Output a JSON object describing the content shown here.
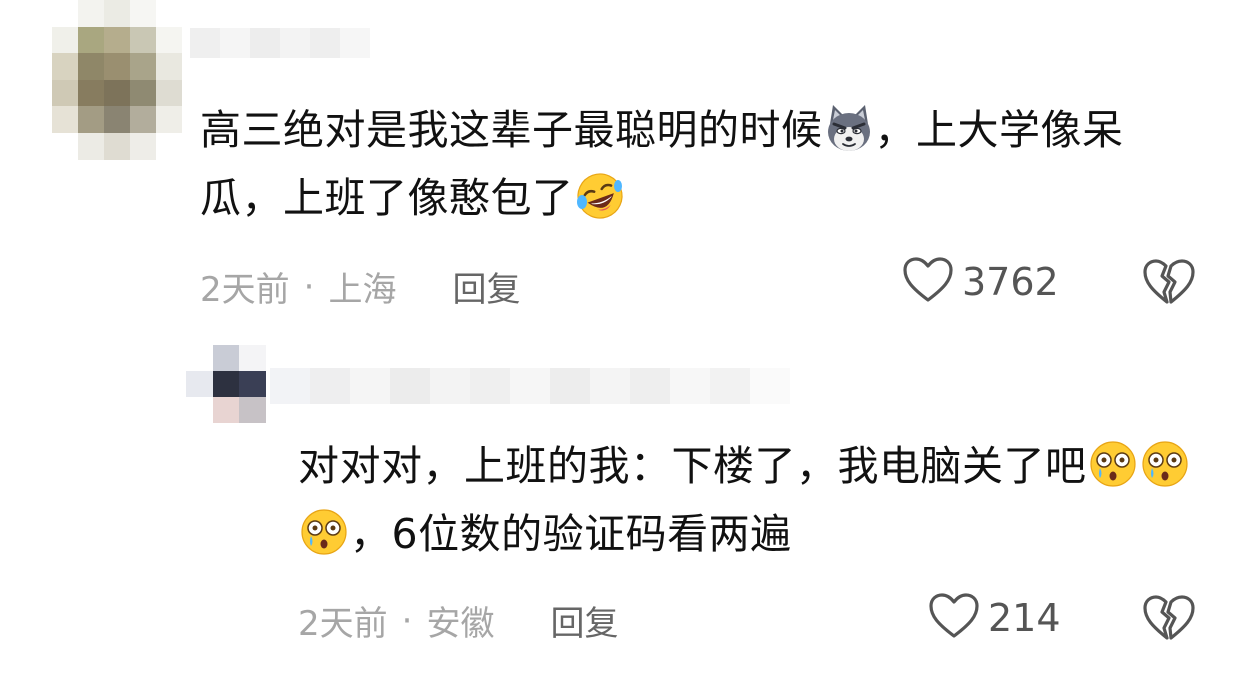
{
  "comments": [
    {
      "text_part1": "高三绝对是我这辈子最聪明的时候",
      "emoji1": "cool-dog-emoji",
      "text_part2": "，上大学像呆瓜，上班了像憨包了",
      "emoji2": "rofl-emoji",
      "time": "2天前",
      "separator": "·",
      "location": "上海",
      "reply_label": "回复",
      "likes": "3762",
      "like_icon": "heart-outline-icon",
      "dislike_icon": "broken-heart-icon"
    },
    {
      "text_part1": "对对对，上班的我：下楼了，我电脑关了吧",
      "emoji1": "shocked-tear-emoji",
      "text_part2": "，6位数的验证码看两遍",
      "time": "2天前",
      "separator": "·",
      "location": "安徽",
      "reply_label": "回复",
      "likes": "214",
      "like_icon": "heart-outline-icon",
      "dislike_icon": "broken-heart-icon"
    }
  ],
  "colors": {
    "text": "#111111",
    "meta": "#a6a6a6",
    "reply": "#666666",
    "icon": "#555555"
  }
}
